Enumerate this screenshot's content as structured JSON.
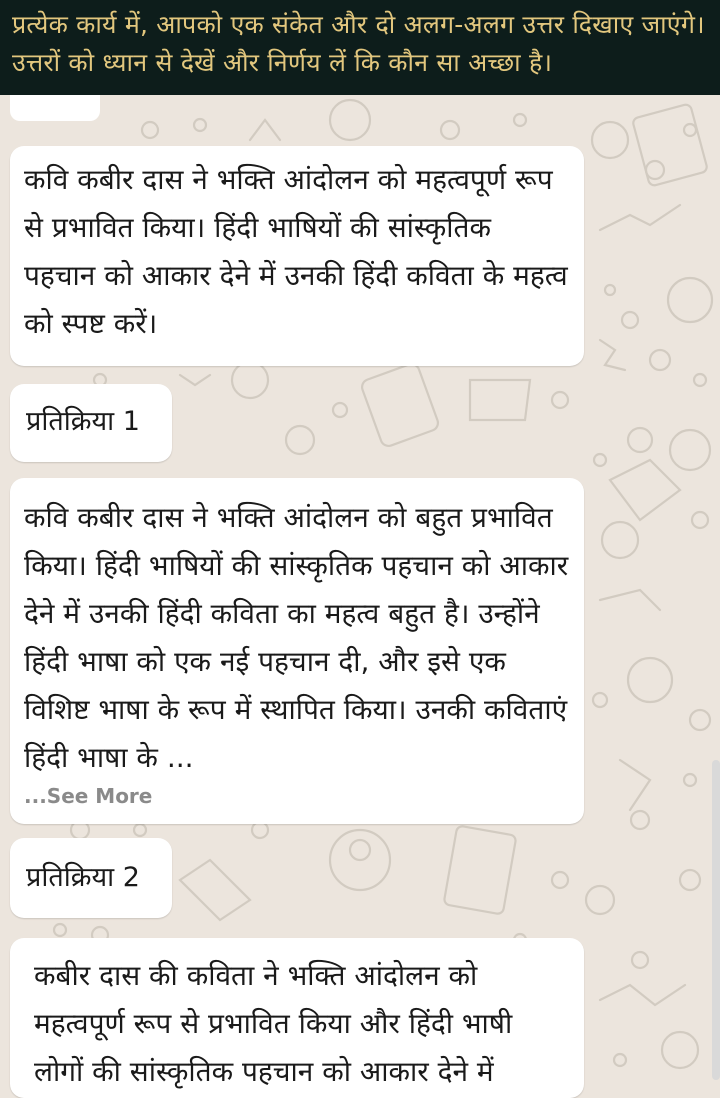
{
  "banner": {
    "text": "प्रत्येक कार्य में, आपको एक संकेत और दो अलग-अलग उत्तर दिखाए जाएंगे। उत्तरों को ध्यान से देखें और निर्णय लें कि कौन सा अच्छा है।"
  },
  "prompt": {
    "text": "कवि कबीर दास ने भक्ति आंदोलन को महत्वपूर्ण रूप से प्रभावित किया। हिंदी भाषियों की सांस्कृतिक पहचान को आकार देने में उनकी हिंदी कविता के महत्व को स्पष्ट करें।"
  },
  "response1": {
    "label": "प्रतिक्रिया 1",
    "text": "कवि कबीर दास ने भक्ति आंदोलन को बहुत प्रभावित किया। हिंदी भाषियों की सांस्कृतिक पहचान को आकार देने में उनकी हिंदी कविता का महत्व बहुत है। उन्होंने हिंदी भाषा को एक नई पहचान दी, और इसे एक विशिष्ट भाषा के रूप में स्थापित किया। उनकी कविताएं हिंदी भाषा के ...",
    "see_more": "...See More"
  },
  "response2": {
    "label": "प्रतिक्रिया 2",
    "text": "कबीर दास की कविता ने भक्ति आंदोलन को महत्वपूर्ण रूप से प्रभावित किया और हिंदी भाषी लोगों की सांस्कृतिक पहचान को आकार देने में"
  },
  "colors": {
    "banner_bg": "#0d1d1b",
    "banner_text": "#e2c77e",
    "chat_bg": "#ece5dd",
    "bubble_bg": "#ffffff",
    "see_more": "#8a8a8a"
  },
  "icons": [
    "chat-wallpaper-doodle-icons"
  ]
}
